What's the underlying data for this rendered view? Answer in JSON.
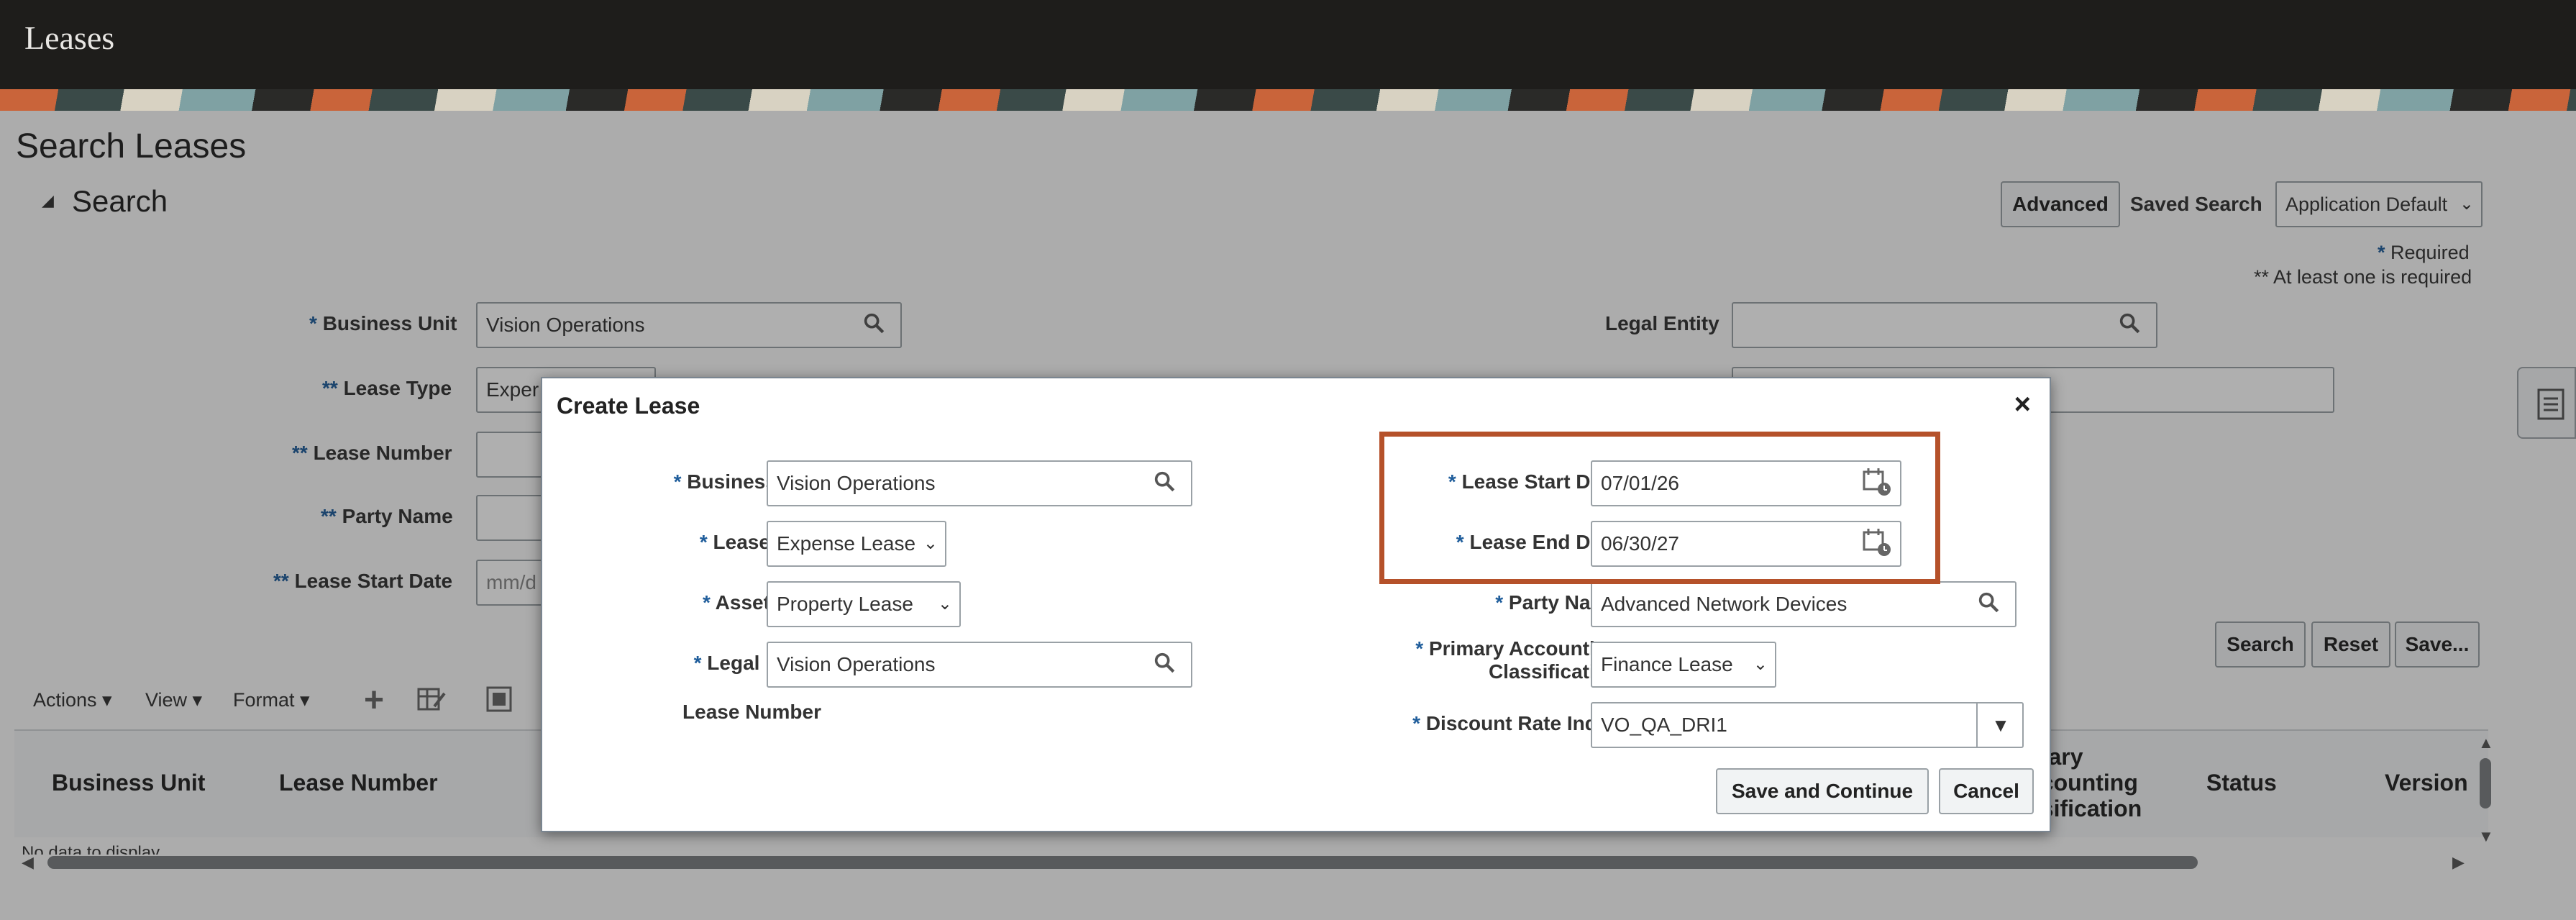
{
  "app": {
    "title": "Leases"
  },
  "page": {
    "title": "Search Leases",
    "search_section": "Search",
    "advanced_button": "Advanced",
    "saved_search_label": "Saved Search",
    "saved_search_value": "Application Default",
    "required_note": "Required",
    "required_star": "*",
    "at_least_one_note": "** At least one is required",
    "fields": {
      "business_unit_label": "Business Unit",
      "business_unit_value": "Vision Operations",
      "lease_type_label": "Lease Type",
      "lease_type_value": "Exper",
      "lease_number_label": "Lease Number",
      "party_name_label": "Party Name",
      "lease_start_date_label": "Lease Start Date",
      "lease_start_date_placeholder": "mm/d",
      "legal_entity_label": "Legal Entity"
    },
    "buttons": {
      "search": "Search",
      "reset": "Reset",
      "save": "Save..."
    },
    "toolbar": {
      "actions": "Actions",
      "view": "View",
      "format": "Format"
    },
    "table": {
      "columns": [
        "Business Unit",
        "Lease Number",
        "mary",
        "ccounting",
        "ssification",
        "Status",
        "Version"
      ],
      "empty_text": "No data to display"
    }
  },
  "dialog": {
    "title": "Create Lease",
    "left_fields": [
      {
        "label": "Business Unit",
        "value": "Vision Operations",
        "required": true
      },
      {
        "label": "Lease Type",
        "value": "Expense Lease",
        "required": true
      },
      {
        "label": "Asset Type",
        "value": "Property Lease",
        "required": true
      },
      {
        "label": "Legal Entity",
        "value": "Vision Operations",
        "required": true
      },
      {
        "label": "Lease Number",
        "value": "",
        "required": false
      }
    ],
    "right_fields": [
      {
        "label": "Lease Start Date",
        "value": "07/01/26",
        "required": true
      },
      {
        "label": "Lease End Date",
        "value": "06/30/27",
        "required": true
      },
      {
        "label": "Party Name",
        "value": "Advanced Network Devices",
        "required": true
      },
      {
        "label": "Primary Accounting",
        "label2": "Classification",
        "value": "Finance Lease",
        "required": true
      },
      {
        "label": "Discount Rate Index",
        "value": "VO_QA_DRI1",
        "required": true
      }
    ],
    "save_continue": "Save and Continue",
    "cancel": "Cancel"
  },
  "colors": {
    "highlight": "#b5512a",
    "required": "#1f5d9b",
    "topbar": "#1e1d1b"
  }
}
